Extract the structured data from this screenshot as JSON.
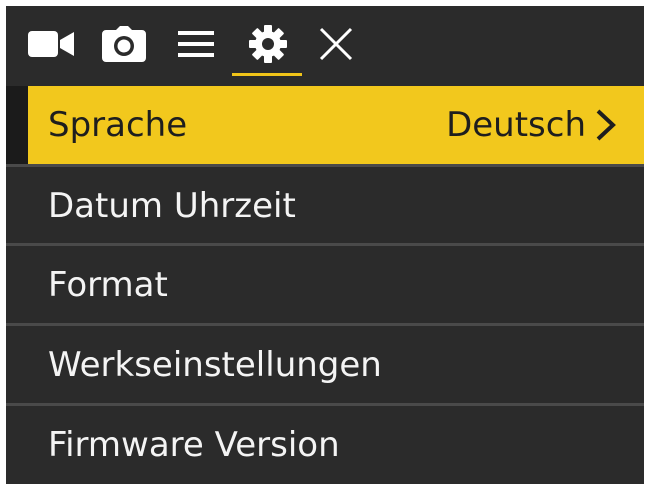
{
  "toolbar": {
    "icons": [
      "video-camera-icon",
      "photo-camera-icon",
      "menu-lines-icon",
      "gear-icon",
      "close-icon"
    ],
    "active_tab": "gear-icon",
    "accent_color": "#f0c419"
  },
  "menu": {
    "items": [
      {
        "label": "Sprache",
        "value": "Deutsch",
        "selected": true
      },
      {
        "label": "Datum Uhrzeit"
      },
      {
        "label": "Format"
      },
      {
        "label": "Werkseinstellungen"
      },
      {
        "label": "Firmware Version"
      }
    ]
  },
  "colors": {
    "background": "#2b2b2b",
    "highlight": "#f2c81d",
    "text": "#f4f4f4",
    "divider": "#4a4a4a"
  }
}
